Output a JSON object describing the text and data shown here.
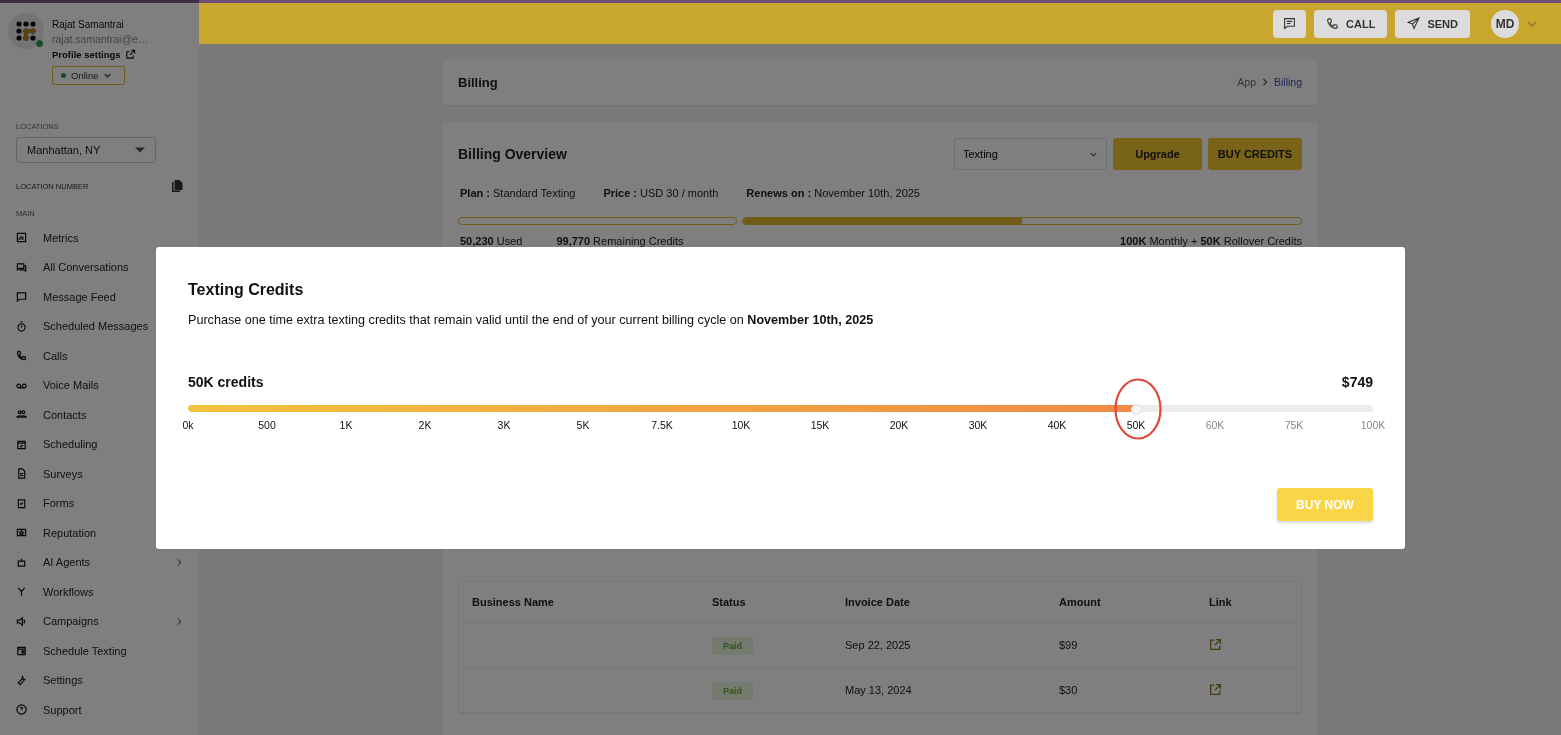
{
  "sidebar": {
    "user": {
      "name": "Rajat Samantrai",
      "email": "rajat.samantrai@e…",
      "profile_link": "Profile settings",
      "online": true
    },
    "status_dropdown": {
      "value": "Online"
    },
    "locations": {
      "label": "LOCATIONS",
      "value": "Manhattan, NY"
    },
    "location_number": {
      "label": "LOCATION NUMBER"
    },
    "section": "MAIN",
    "items": [
      {
        "label": "Metrics",
        "expandable": false
      },
      {
        "label": "All Conversations",
        "expandable": false
      },
      {
        "label": "Message Feed",
        "expandable": false
      },
      {
        "label": "Scheduled Messages",
        "expandable": false
      },
      {
        "label": "Calls",
        "expandable": false
      },
      {
        "label": "Voice Mails",
        "expandable": false
      },
      {
        "label": "Contacts",
        "expandable": false
      },
      {
        "label": "Scheduling",
        "expandable": false
      },
      {
        "label": "Surveys",
        "expandable": false
      },
      {
        "label": "Forms",
        "expandable": false
      },
      {
        "label": "Reputation",
        "expandable": false
      },
      {
        "label": "AI Agents",
        "expandable": true
      },
      {
        "label": "Workflows",
        "expandable": false
      },
      {
        "label": "Campaigns",
        "expandable": true
      },
      {
        "label": "Schedule Texting",
        "expandable": false
      },
      {
        "label": "Settings",
        "expandable": false
      },
      {
        "label": "Support",
        "expandable": false
      }
    ]
  },
  "top_bar": {
    "buttons": [
      "CALL",
      "SEND"
    ],
    "avatar": "MD"
  },
  "page_header": {
    "title": "Billing",
    "breadcrumb": [
      {
        "label": "App",
        "selected": false
      },
      {
        "label": "Billing",
        "selected": true
      }
    ]
  },
  "billing_overview": {
    "title": "Billing Overview",
    "product_select": "Texting",
    "buttons": [
      "Upgrade",
      "BUY CREDITS"
    ],
    "details": [
      "**Plan :** Standard Texting",
      "**Price :** USD 30 / month",
      "**Renews on :** November 10th, 2025"
    ],
    "usage_bar": {
      "level": 0.5
    },
    "stats": [
      "**50,230** Used",
      "**99,770** Remaining Credits"
    ],
    "stats_right": "**100K** Monthly + **50K** Rollover Credits"
  },
  "invoices": {
    "columns": [
      "Business Name",
      "Status",
      "Invoice Date",
      "Amount",
      "Link"
    ],
    "rows": [
      {
        "status": "Paid",
        "date": "Sep 22, 2025",
        "amount": "$99"
      },
      {
        "status": "Paid",
        "date": "May 13, 2024",
        "amount": "$30"
      }
    ]
  },
  "modal": {
    "title": "Texting Credits",
    "description": "Purchase one time extra texting credits that remain valid until the end of your current billing cycle on **November 10th, 2025**",
    "amount_label": "50K credits",
    "price": "$749",
    "slider": {
      "level": 0.8,
      "ticks": [
        "0k",
        "500",
        "1K",
        "2K",
        "3K",
        "5K",
        "7.5K",
        "10K",
        "15K",
        "20K",
        "30K",
        "40K",
        "50K",
        "60K",
        "75K",
        "100K"
      ]
    },
    "button": "BUY NOW"
  }
}
